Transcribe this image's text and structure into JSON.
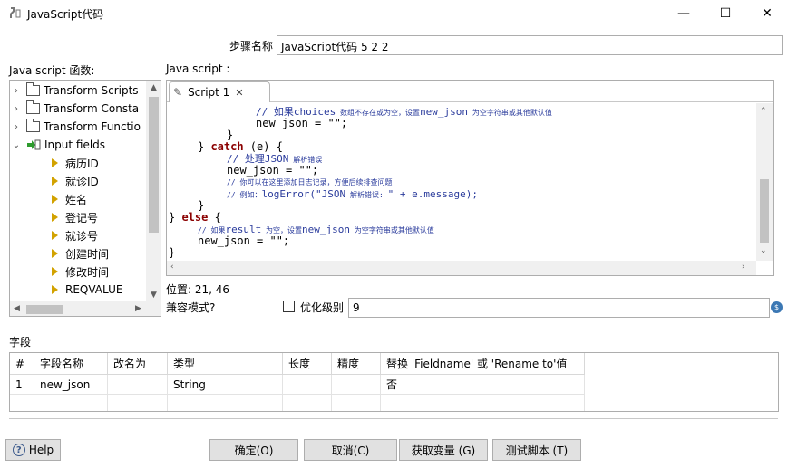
{
  "window": {
    "title": "JavaScript代码",
    "minimize_glyph": "—",
    "maximize_glyph": "☐",
    "close_glyph": "✕"
  },
  "step": {
    "label": "步骤名称",
    "value": "JavaScript代码 5 2 2"
  },
  "function_panel": {
    "label": "Java script 函数:",
    "folders": [
      "Transform Scripts",
      "Transform Consta",
      "Transform Functio"
    ],
    "input_fields_label": "Input fields",
    "fields": [
      "病历ID",
      "就诊ID",
      "姓名",
      "登记号",
      "就诊号",
      "创建时间",
      "修改时间",
      "REQVALUE"
    ]
  },
  "script_panel": {
    "label": "Java script :",
    "tab_label": "Script 1",
    "code": {
      "l1_kw": "// 如果choices",
      "l1_sm": " 数组不存在或为空，设置",
      "l1_kw2": "new_json",
      "l1_sm2": " 为空字符串或其他默认值",
      "l2": "new_json = \"\";",
      "l3": "}",
      "l4a": "} ",
      "l4kw": "catch",
      "l4b": " (e) {",
      "l5a": "// 处理",
      "l5b": "JSON",
      "l5c": " 解析错误",
      "l6": "new_json = \"\";",
      "l7": "// 你可以在这里添加日志记录，方便后续排查问题",
      "l8a": "// 例如：",
      "l8b": "logError(\"JSON",
      "l8c": " 解析错误: ",
      "l8d": "\" + e.message);",
      "l9": "}",
      "l10a": "} ",
      "l10kw": "else",
      "l10b": " {",
      "l11a": "// 如果",
      "l11b": "result",
      "l11c": " 为空，设置",
      "l11d": "new_json",
      "l11e": " 为空字符串或其他默认值",
      "l12": "new_json = \"\";",
      "l13": "}"
    }
  },
  "position": "位置: 21, 46",
  "compat": {
    "label": "兼容模式?",
    "checked": false,
    "opt_label": "优化级别",
    "opt_value": "9"
  },
  "fields": {
    "label": "字段",
    "columns": [
      "#",
      "字段名称",
      "改名为",
      "类型",
      "长度",
      "精度",
      "替换 'Fieldname' 或 'Rename to'值"
    ],
    "rows": [
      [
        "1",
        "new_json",
        "",
        "String",
        "",
        "",
        "否"
      ]
    ]
  },
  "buttons": {
    "help": "Help",
    "ok": "确定(O)",
    "cancel": "取消(C)",
    "get_vars": "获取变量 (G)",
    "test": "测试脚本 (T)"
  }
}
